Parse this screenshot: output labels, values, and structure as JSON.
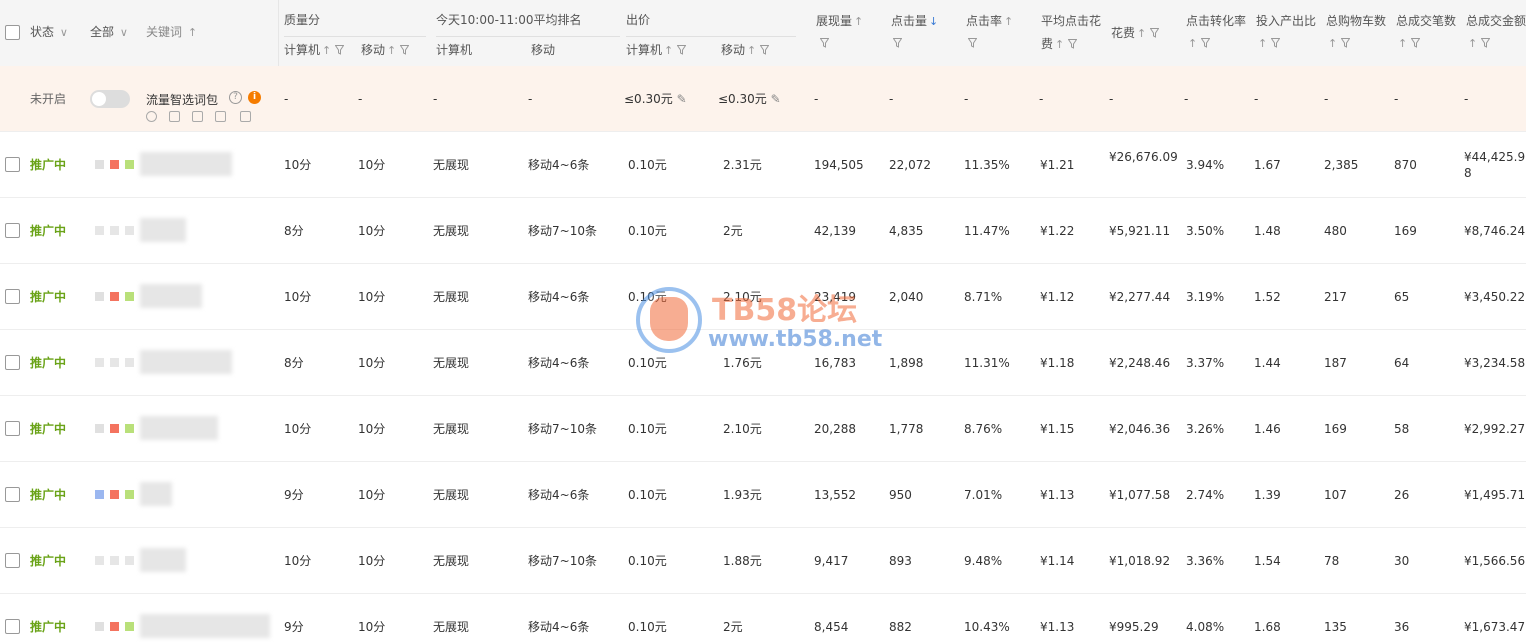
{
  "header": {
    "status": "状态",
    "all": "全部",
    "keyword": "关键词",
    "quality": "质量分",
    "quality_pc": "计算机",
    "quality_mobile": "移动",
    "rank": "今天10:00-11:00平均排名",
    "rank_pc": "计算机",
    "rank_mobile": "移动",
    "bid": "出价",
    "bid_pc": "计算机",
    "bid_mobile": "移动",
    "impressions": "展现量",
    "clicks": "点击量",
    "ctr": "点击率",
    "avg_cpc_1": "平均点击花",
    "avg_cpc_2": "费",
    "spend": "花费",
    "cvr": "点击转化率",
    "roi": "投入产出比",
    "cart": "总购物车数",
    "orders": "总成交笔数",
    "gmv": "总成交金额"
  },
  "summary": {
    "status": "未开启",
    "label": "流量智选词包",
    "quality_pc": "-",
    "quality_mobile": "-",
    "rank_pc": "-",
    "rank_mobile": "-",
    "bid_pc": "≤0.30元",
    "bid_mobile": "≤0.30元",
    "impressions": "-",
    "clicks": "-",
    "ctr": "-",
    "avg_cpc": "-",
    "spend": "-",
    "cvr": "-",
    "roi": "-",
    "cart": "-",
    "orders": "-",
    "gmv": "-"
  },
  "rows": [
    {
      "status": "推广中",
      "q_pc": "10分",
      "q_m": "10分",
      "r_pc": "无展现",
      "r_m": "移动4~6条",
      "b_pc": "0.10元",
      "b_m": "2.31元",
      "imp": "194,505",
      "clk": "22,072",
      "ctr": "11.35%",
      "cpc": "¥1.21",
      "spend1": "¥26,676.0",
      "spend2": "9",
      "cvr": "3.94%",
      "roi": "1.67",
      "cart": "2,385",
      "orders": "870",
      "gmv1": "¥44,425.9",
      "gmv2": "8"
    },
    {
      "status": "推广中",
      "q_pc": "8分",
      "q_m": "10分",
      "r_pc": "无展现",
      "r_m": "移动7~10条",
      "b_pc": "0.10元",
      "b_m": "2元",
      "imp": "42,139",
      "clk": "4,835",
      "ctr": "11.47%",
      "cpc": "¥1.22",
      "spend1": "¥5,921.11",
      "spend2": "",
      "cvr": "3.50%",
      "roi": "1.48",
      "cart": "480",
      "orders": "169",
      "gmv1": "¥8,746.24",
      "gmv2": ""
    },
    {
      "status": "推广中",
      "q_pc": "10分",
      "q_m": "10分",
      "r_pc": "无展现",
      "r_m": "移动4~6条",
      "b_pc": "0.10元",
      "b_m": "2.10元",
      "imp": "23,419",
      "clk": "2,040",
      "ctr": "8.71%",
      "cpc": "¥1.12",
      "spend1": "¥2,277.44",
      "spend2": "",
      "cvr": "3.19%",
      "roi": "1.52",
      "cart": "217",
      "orders": "65",
      "gmv1": "¥3,450.22",
      "gmv2": ""
    },
    {
      "status": "推广中",
      "q_pc": "8分",
      "q_m": "10分",
      "r_pc": "无展现",
      "r_m": "移动4~6条",
      "b_pc": "0.10元",
      "b_m": "1.76元",
      "imp": "16,783",
      "clk": "1,898",
      "ctr": "11.31%",
      "cpc": "¥1.18",
      "spend1": "¥2,248.46",
      "spend2": "",
      "cvr": "3.37%",
      "roi": "1.44",
      "cart": "187",
      "orders": "64",
      "gmv1": "¥3,234.58",
      "gmv2": ""
    },
    {
      "status": "推广中",
      "q_pc": "10分",
      "q_m": "10分",
      "r_pc": "无展现",
      "r_m": "移动7~10条",
      "b_pc": "0.10元",
      "b_m": "2.10元",
      "imp": "20,288",
      "clk": "1,778",
      "ctr": "8.76%",
      "cpc": "¥1.15",
      "spend1": "¥2,046.36",
      "spend2": "",
      "cvr": "3.26%",
      "roi": "1.46",
      "cart": "169",
      "orders": "58",
      "gmv1": "¥2,992.27",
      "gmv2": ""
    },
    {
      "status": "推广中",
      "q_pc": "9分",
      "q_m": "10分",
      "r_pc": "无展现",
      "r_m": "移动4~6条",
      "b_pc": "0.10元",
      "b_m": "1.93元",
      "imp": "13,552",
      "clk": "950",
      "ctr": "7.01%",
      "cpc": "¥1.13",
      "spend1": "¥1,077.58",
      "spend2": "",
      "cvr": "2.74%",
      "roi": "1.39",
      "cart": "107",
      "orders": "26",
      "gmv1": "¥1,495.71",
      "gmv2": ""
    },
    {
      "status": "推广中",
      "q_pc": "10分",
      "q_m": "10分",
      "r_pc": "无展现",
      "r_m": "移动7~10条",
      "b_pc": "0.10元",
      "b_m": "1.88元",
      "imp": "9,417",
      "clk": "893",
      "ctr": "9.48%",
      "cpc": "¥1.14",
      "spend1": "¥1,018.92",
      "spend2": "",
      "cvr": "3.36%",
      "roi": "1.54",
      "cart": "78",
      "orders": "30",
      "gmv1": "¥1,566.56",
      "gmv2": ""
    },
    {
      "status": "推广中",
      "q_pc": "9分",
      "q_m": "10分",
      "r_pc": "无展现",
      "r_m": "移动4~6条",
      "b_pc": "0.10元",
      "b_m": "2元",
      "imp": "8,454",
      "clk": "882",
      "ctr": "10.43%",
      "cpc": "¥1.13",
      "spend1": "¥995.29",
      "spend2": "",
      "cvr": "4.08%",
      "roi": "1.68",
      "cart": "135",
      "orders": "36",
      "gmv1": "¥1,673.47",
      "gmv2": ""
    }
  ],
  "watermark": {
    "title": "TB58论坛",
    "url": "www.tb58.net"
  },
  "colors": {
    "status_active": "#6aa318",
    "summary_bg": "#fdf3ec",
    "header_bg": "#f5f5f5",
    "sort_active": "#3a7bd5"
  }
}
